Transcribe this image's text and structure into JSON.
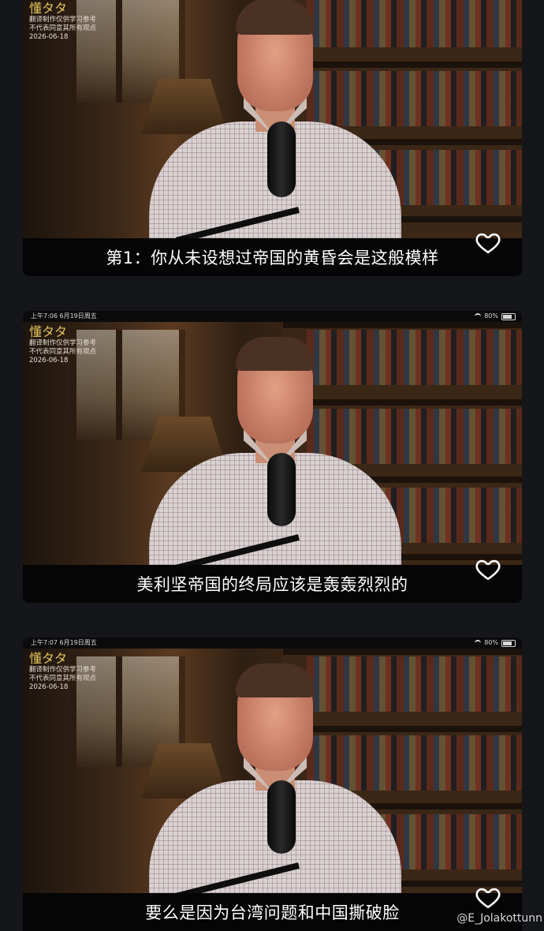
{
  "panels": [
    {
      "status": null,
      "watermark": {
        "brand": "懂タタ",
        "line1": "翻译制作仅供学习参考",
        "line2": "不代表同意其所有观点",
        "date": "2026-06-18"
      },
      "subtitle": "第1：你从未设想过帝国的黄昏会是这般模样",
      "heart_icon": "heart-outline-icon"
    },
    {
      "status": {
        "time": "上午7:06 6月19日周五",
        "battery": "80%"
      },
      "watermark": {
        "brand": "懂タタ",
        "line1": "翻译制作仅供学习参考",
        "line2": "不代表同意其所有观点",
        "date": "2026-06-18"
      },
      "subtitle": "美利坚帝国的终局应该是轰轰烈烈的",
      "heart_icon": "heart-outline-icon"
    },
    {
      "status": {
        "time": "上午7:07 6月19日周五",
        "battery": "80%"
      },
      "watermark": {
        "brand": "懂タタ",
        "line1": "翻译制作仅供学习参考",
        "line2": "不代表同意其所有观点",
        "date": "2026-06-18"
      },
      "subtitle": "要么是因为台湾问题和中国撕破脸",
      "heart_icon": "heart-outline-icon"
    }
  ],
  "overlay_watermark": "@E_Jolakottunn"
}
